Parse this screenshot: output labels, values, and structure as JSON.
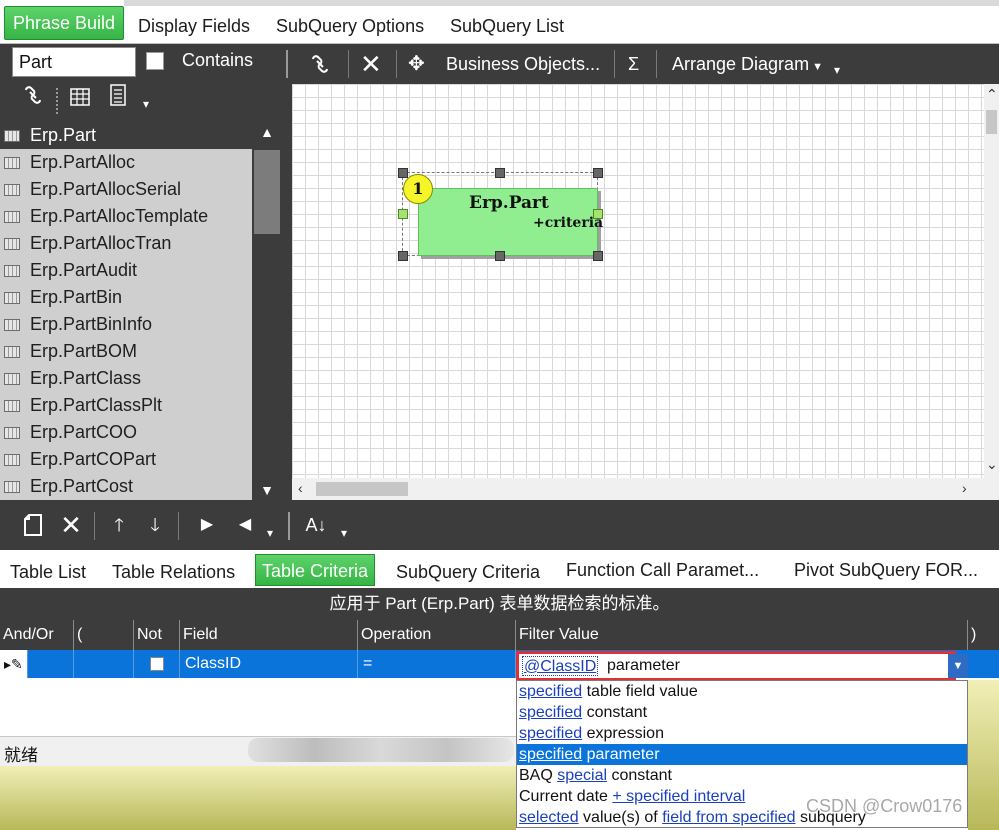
{
  "top_tabs": [
    {
      "label": "Phrase Build"
    },
    {
      "label": "Display Fields"
    },
    {
      "label": "SubQuery Options"
    },
    {
      "label": "SubQuery List"
    }
  ],
  "search": {
    "value": "Part",
    "contains_label": "Contains"
  },
  "tables": [
    "Erp.Part",
    "Erp.PartAlloc",
    "Erp.PartAllocSerial",
    "Erp.PartAllocTemplate",
    "Erp.PartAllocTran",
    "Erp.PartAudit",
    "Erp.PartBin",
    "Erp.PartBinInfo",
    "Erp.PartBOM",
    "Erp.PartClass",
    "Erp.PartClassPlt",
    "Erp.PartCOO",
    "Erp.PartCOPart",
    "Erp.PartCost"
  ],
  "canvas_toolbar": {
    "business_objects": "Business Objects...",
    "sigma": "Σ",
    "arrange": "Arrange Diagram"
  },
  "diagram": {
    "badge": "1",
    "node_title": "Erp.Part",
    "node_sub": "+criteria"
  },
  "bottom_tabs": [
    {
      "label": "Table List"
    },
    {
      "label": "Table Relations"
    },
    {
      "label": "Table Criteria"
    },
    {
      "label": "SubQuery Criteria"
    },
    {
      "label": "Function Call Paramet..."
    },
    {
      "label": "Pivot SubQuery FOR..."
    }
  ],
  "criteria_caption": "应用于 Part (Erp.Part) 表单数据检索的标准。",
  "grid": {
    "headers": [
      "And/Or",
      "(",
      "Not",
      "Field",
      "Operation",
      "Filter Value",
      ")"
    ],
    "row": {
      "field": "ClassID",
      "operation": "=",
      "filter_chip": "@ClassID",
      "filter_rest": "parameter"
    }
  },
  "dropdown": [
    {
      "link": "specified",
      "text": " table field value"
    },
    {
      "link": "specified",
      "text": " constant"
    },
    {
      "link": "specified",
      "text": " expression"
    },
    {
      "link": "specified",
      "text": " parameter"
    },
    {
      "prefix": "BAQ ",
      "link": "special",
      "text": " constant"
    },
    {
      "prefix": "Current date ",
      "link": "+ specified interval",
      "text": ""
    },
    {
      "link": "selected",
      "text": " value(s) of ",
      "link2": "field from specified",
      "text2": " subquery"
    }
  ],
  "status": {
    "text": "就绪"
  },
  "watermark": "CSDN @Crow0176",
  "colors": {
    "accent_green": "#36b545",
    "selection_blue": "#0a74da",
    "dark_panel": "#3c3c3c",
    "highlight_red": "#e0303a"
  }
}
